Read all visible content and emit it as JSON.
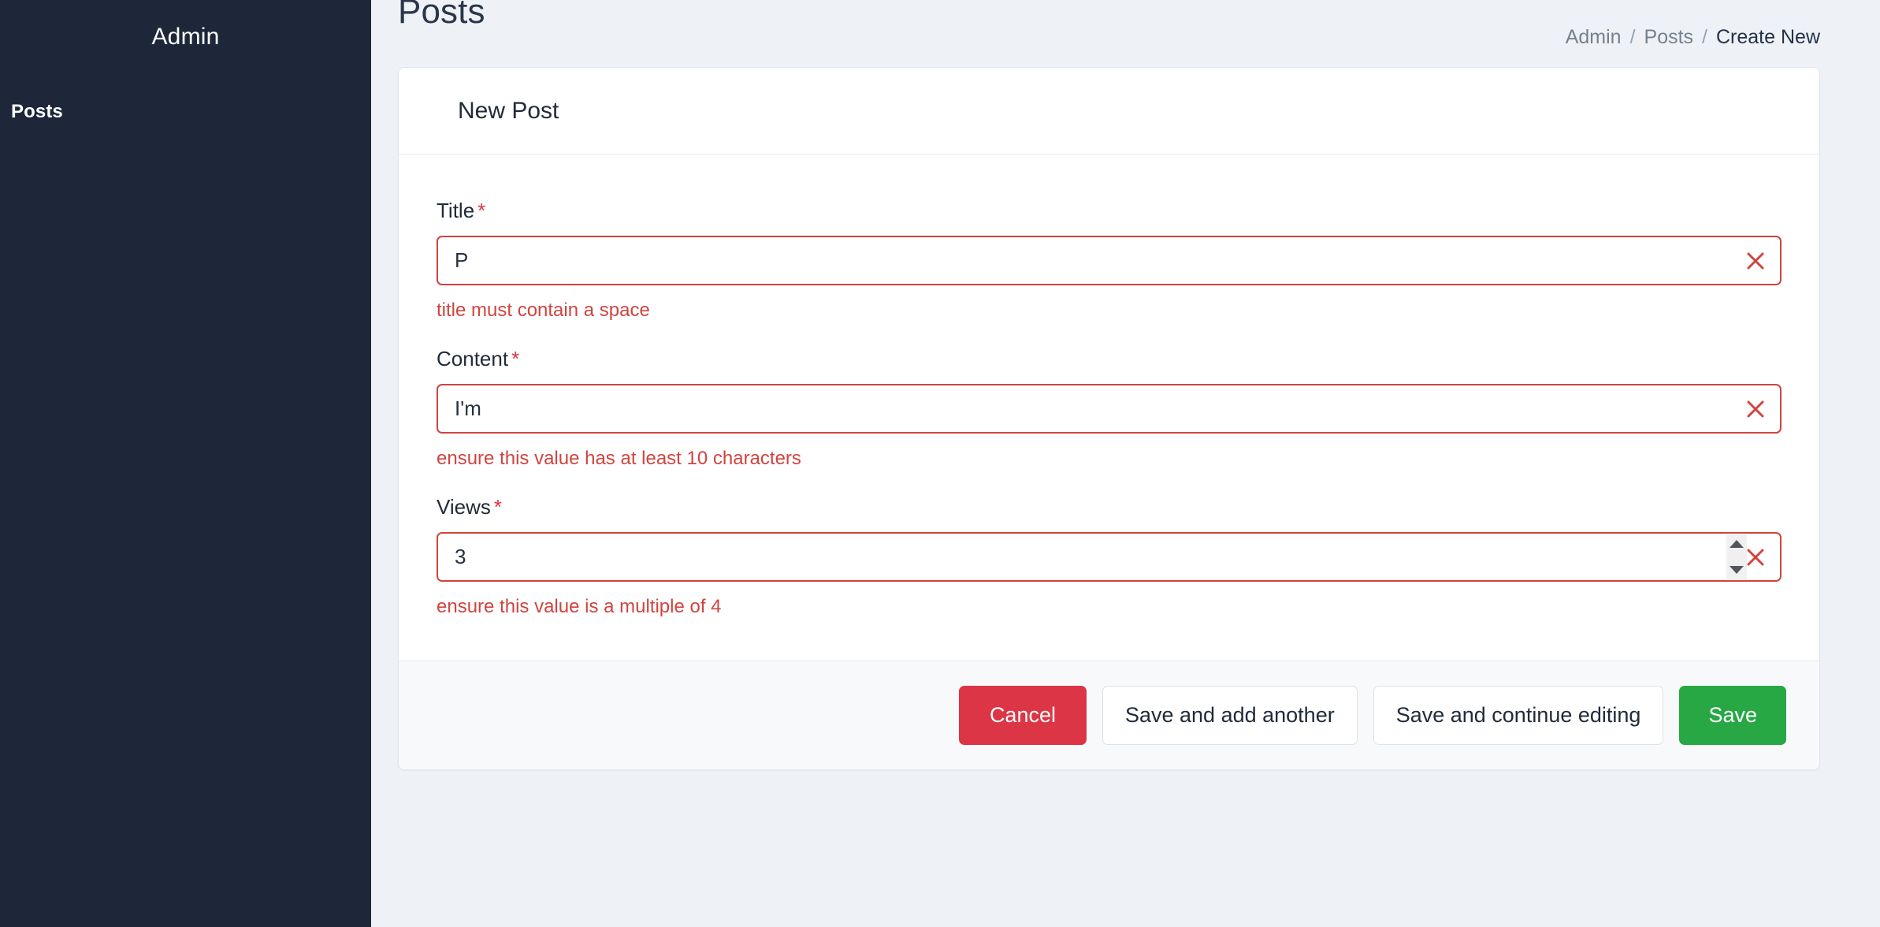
{
  "sidebar": {
    "brand": "Admin",
    "items": [
      {
        "label": "Posts"
      }
    ]
  },
  "header": {
    "title": "Posts",
    "breadcrumb": [
      {
        "label": "Admin",
        "current": false
      },
      {
        "label": "Posts",
        "current": false
      },
      {
        "label": "Create New",
        "current": true
      }
    ],
    "separator": "/"
  },
  "card": {
    "title": "New Post",
    "fields": [
      {
        "label": "Title",
        "required_mark": "*",
        "value": "P",
        "error": "title must contain a space",
        "clear_icon": "close-icon"
      },
      {
        "label": "Content",
        "required_mark": "*",
        "value": "I'm",
        "error": "ensure this value has at least 10 characters",
        "clear_icon": "close-icon"
      },
      {
        "label": "Views",
        "required_mark": "*",
        "value": "3",
        "error": "ensure this value is a multiple of 4",
        "clear_icon": "close-icon"
      }
    ],
    "buttons": {
      "cancel": "Cancel",
      "save_add_another": "Save and add another",
      "save_continue": "Save and continue editing",
      "save": "Save"
    }
  },
  "colors": {
    "sidebar_bg": "#1d2739",
    "page_bg": "#eef2f7",
    "danger": "#dc3545",
    "success": "#28a745",
    "error_text": "#d0443f",
    "muted_text": "#76808e"
  }
}
